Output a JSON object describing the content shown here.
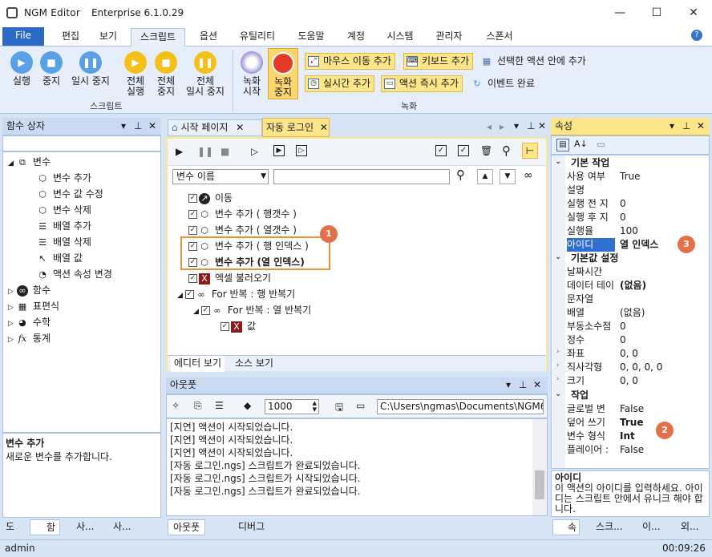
{
  "window": {
    "app": "NGM Editor",
    "edition": "Enterprise 6.1.0.29",
    "minimize": "—",
    "maximize": "☐",
    "close": "✕"
  },
  "menu_tabs": [
    "File",
    "편집",
    "보기",
    "스크립트",
    "옵션",
    "유틸리티",
    "도움말",
    "계정",
    "시스템",
    "관리자",
    "스폰서"
  ],
  "ribbon": {
    "script_group": {
      "label": "스크립트",
      "run": "실행",
      "stop": "중지",
      "pause": "일시 중지",
      "run_all": [
        "전체",
        "실행"
      ],
      "stop_all": [
        "전체",
        "중지"
      ],
      "pause_all": [
        "전체",
        "일시 중지"
      ]
    },
    "record_group": {
      "label": "녹화",
      "rec_start": [
        "녹화",
        "시작"
      ],
      "rec_stop": [
        "녹화",
        "중지"
      ],
      "mouse_move": "마우스 이동 추가",
      "keyboard": "키보드 추가",
      "in_action": "선택한 액션 안에 추가",
      "realtime": "실시간 추가",
      "action_now": "액션 즉시 추가",
      "event_end": "이벤트 완료"
    }
  },
  "left_panel": {
    "title": "함수 상자",
    "tree": {
      "variables": "변수",
      "var_items": [
        "변수 추가",
        "변수 값 수정",
        "변수 삭제",
        "배열 추가",
        "배열 삭제",
        "배열 값",
        "액션 속성 변경"
      ],
      "others": [
        "함수",
        "표편식",
        "수학",
        "통계"
      ]
    },
    "help_title": "변수 추가",
    "help_text": "새로운 변수를 추가합니다.",
    "bottom_tabs": [
      "도",
      "함",
      "사...",
      "사...",
      ""
    ]
  },
  "doc_tabs": [
    "시작 페이지",
    "자동 로그인"
  ],
  "editor": {
    "filter_select": "변수 이름",
    "actions": [
      {
        "label": "이동",
        "bold": false
      },
      {
        "label": "변수 추가 ( 행갯수 )",
        "bold": false
      },
      {
        "label": "변수 추가 ( 열갯수 )",
        "bold": false
      },
      {
        "label": "변수 추가 ( 행 인덱스 )",
        "bold": false
      },
      {
        "label": "변수 추가 (열 인덱스)",
        "bold": true
      },
      {
        "label": "엑셀 불러오기",
        "bold": false
      },
      {
        "label": "For 반복 : 행 반복기",
        "bold": false
      },
      {
        "label": "For 반복 : 열 반복기",
        "bold": false
      },
      {
        "label": "값",
        "bold": false
      }
    ],
    "view_tabs": [
      "에디터 보기",
      "소스 보기"
    ]
  },
  "output": {
    "title": "아웃풋",
    "count": "1000",
    "path": "C:\\Users\\ngmas\\Documents\\NGM6\\",
    "lines": [
      "[지연] 액션이 시작되었습니다.",
      "[지연] 액션이 시작되었습니다.",
      "[지연] 액션이 시작되었습니다.",
      "[자동 로그인.ngs] 스크립트가 완료되었습니다.",
      "[자동 로그인.ngs] 스크립트가 시작되었습니다.",
      "[자동 로그인.ngs] 스크립트가 완료되었습니다."
    ],
    "tabs": [
      "아웃풋",
      "디버그"
    ]
  },
  "properties": {
    "title": "속성",
    "cat_basic": "기본 작업",
    "basic": [
      {
        "k": "사용 여부",
        "v": "True"
      },
      {
        "k": "설명",
        "v": ""
      },
      {
        "k": "실행 전 지",
        "v": "0"
      },
      {
        "k": "실행 후 지",
        "v": "0"
      },
      {
        "k": "실행율",
        "v": "100"
      },
      {
        "k": "아이디",
        "v": "열 인덱스"
      }
    ],
    "cat_default": "기본값 설정",
    "defaults": [
      {
        "k": "날짜시간",
        "v": ""
      },
      {
        "k": "데이터 테이",
        "v": "(없음)"
      },
      {
        "k": "문자열",
        "v": ""
      },
      {
        "k": "배열",
        "v": "(없음)"
      },
      {
        "k": "부동소수점",
        "v": "0"
      },
      {
        "k": "정수",
        "v": "0"
      },
      {
        "k": "좌표",
        "v": "0, 0"
      },
      {
        "k": "직사각형",
        "v": "0, 0, 0, 0"
      },
      {
        "k": "크기",
        "v": "0, 0"
      }
    ],
    "cat_work": "작업",
    "work": [
      {
        "k": "글로벌 변",
        "v": "False"
      },
      {
        "k": "덮어 쓰기",
        "v": "True"
      },
      {
        "k": "변수 형식",
        "v": "Int"
      },
      {
        "k": "플레이어 :",
        "v": "False"
      }
    ],
    "help_title": "아이디",
    "help_text": "이 액션의 아이디를 입력하세요. 아이디는 스크립트 안에서 유니크 해야 합니다.",
    "bottom_tabs": [
      "속",
      "스크...",
      "이...",
      "외..."
    ]
  },
  "badges": [
    "1",
    "2",
    "3"
  ],
  "status": {
    "user": "admin",
    "time": "00:09:26"
  }
}
